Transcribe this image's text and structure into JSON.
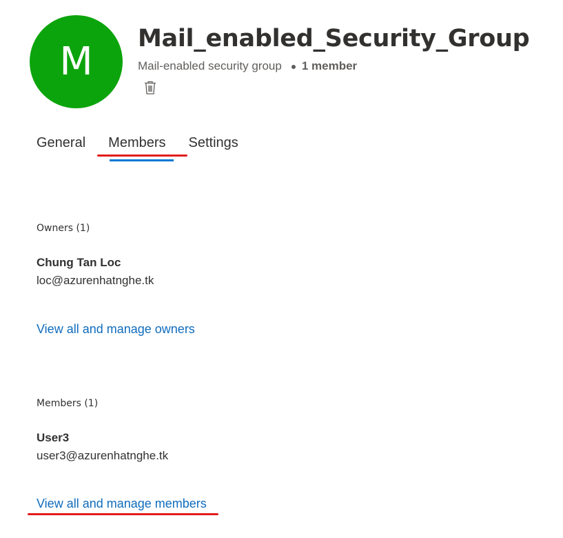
{
  "group": {
    "avatar_initial": "M",
    "title": "Mail_enabled_Security_Group",
    "type": "Mail-enabled security group",
    "member_count": "1 member",
    "avatar_color": "#0ca40c"
  },
  "tabs": [
    {
      "label": "General"
    },
    {
      "label": "Members",
      "active": true
    },
    {
      "label": "Settings"
    }
  ],
  "owners": {
    "heading": "Owners (1)",
    "items": [
      {
        "name": "Chung Tan Loc",
        "email": "loc@azurenhatnghe.tk"
      }
    ],
    "manage_link": "View all and manage owners"
  },
  "members": {
    "heading": "Members (1)",
    "items": [
      {
        "name": "User3",
        "email": "user3@azurenhatnghe.tk"
      }
    ],
    "manage_link": "View all and manage members"
  },
  "colors": {
    "accent": "#0078d4",
    "link": "#0f6cbd",
    "annotation": "#e21c1c"
  },
  "icons": {
    "delete": "trash-icon"
  }
}
